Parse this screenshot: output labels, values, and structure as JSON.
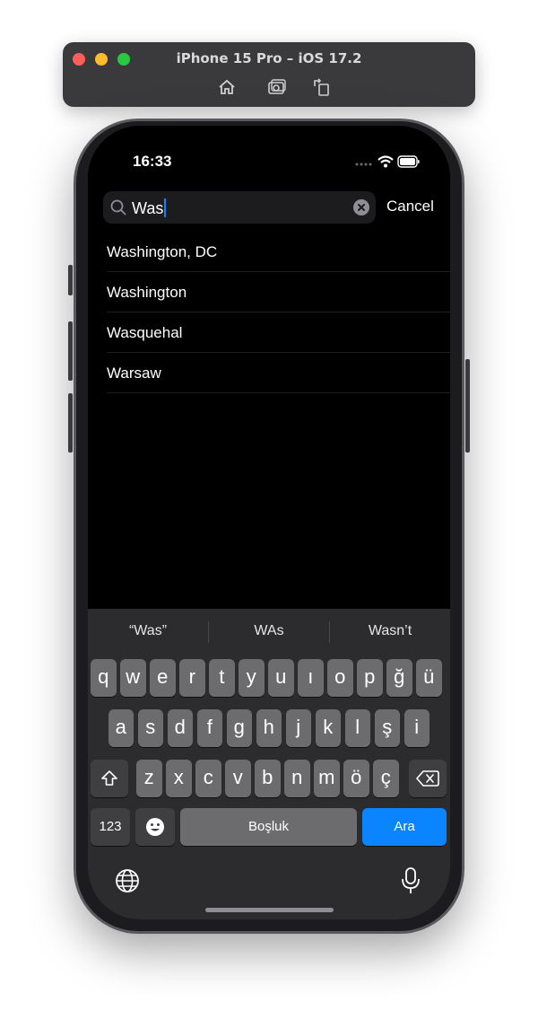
{
  "simulator": {
    "title": "iPhone 15 Pro – iOS 17.2",
    "tools": [
      "home-icon",
      "screenshot-icon",
      "rotate-icon"
    ]
  },
  "status_bar": {
    "time": "16:33",
    "icons": [
      "cellular-dots-icon",
      "wifi-icon",
      "battery-icon"
    ]
  },
  "search": {
    "value": "Was",
    "cancel_label": "Cancel"
  },
  "results": [
    "Washington, DC",
    "Washington",
    "Wasquehal",
    "Warsaw"
  ],
  "keyboard": {
    "suggestions": [
      "“Was”",
      "WAs",
      "Wasn’t"
    ],
    "row1": [
      "q",
      "w",
      "e",
      "r",
      "t",
      "y",
      "u",
      "ı",
      "o",
      "p",
      "ğ",
      "ü"
    ],
    "row2": [
      "a",
      "s",
      "d",
      "f",
      "g",
      "h",
      "j",
      "k",
      "l",
      "ş",
      "i"
    ],
    "row3": [
      "z",
      "x",
      "c",
      "v",
      "b",
      "n",
      "m",
      "ö",
      "ç"
    ],
    "numbers_label": "123",
    "space_label": "Boşluk",
    "return_label": "Ara",
    "accent_color": "#0a84ff"
  }
}
